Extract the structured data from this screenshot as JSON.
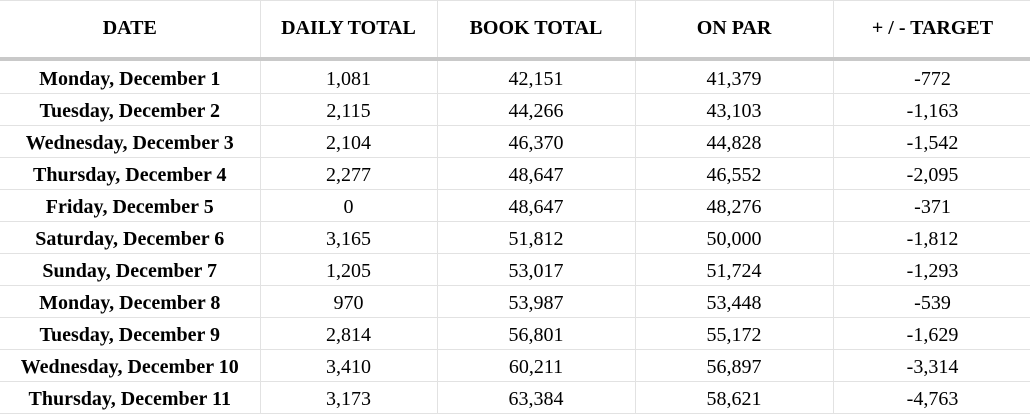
{
  "table": {
    "headers": {
      "date": "DATE",
      "daily_total": "DAILY TOTAL",
      "book_total": "BOOK TOTAL",
      "on_par": "ON PAR",
      "target": "+ / - TARGET"
    },
    "rows": [
      {
        "date": "Monday, December 1",
        "daily_total": "1,081",
        "book_total": "42,151",
        "on_par": "41,379",
        "target": "-772"
      },
      {
        "date": "Tuesday, December 2",
        "daily_total": "2,115",
        "book_total": "44,266",
        "on_par": "43,103",
        "target": "-1,163"
      },
      {
        "date": "Wednesday, December 3",
        "daily_total": "2,104",
        "book_total": "46,370",
        "on_par": "44,828",
        "target": "-1,542"
      },
      {
        "date": "Thursday, December 4",
        "daily_total": "2,277",
        "book_total": "48,647",
        "on_par": "46,552",
        "target": "-2,095"
      },
      {
        "date": "Friday, December 5",
        "daily_total": "0",
        "book_total": "48,647",
        "on_par": "48,276",
        "target": "-371"
      },
      {
        "date": "Saturday, December 6",
        "daily_total": "3,165",
        "book_total": "51,812",
        "on_par": "50,000",
        "target": "-1,812"
      },
      {
        "date": "Sunday, December 7",
        "daily_total": "1,205",
        "book_total": "53,017",
        "on_par": "51,724",
        "target": "-1,293"
      },
      {
        "date": "Monday, December 8",
        "daily_total": "970",
        "book_total": "53,987",
        "on_par": "53,448",
        "target": "-539"
      },
      {
        "date": "Tuesday, December 9",
        "daily_total": "2,814",
        "book_total": "56,801",
        "on_par": "55,172",
        "target": "-1,629"
      },
      {
        "date": "Wednesday, December 10",
        "daily_total": "3,410",
        "book_total": "60,211",
        "on_par": "56,897",
        "target": "-3,314"
      },
      {
        "date": "Thursday, December 11",
        "daily_total": "3,173",
        "book_total": "63,384",
        "on_par": "58,621",
        "target": "-4,763"
      }
    ]
  }
}
